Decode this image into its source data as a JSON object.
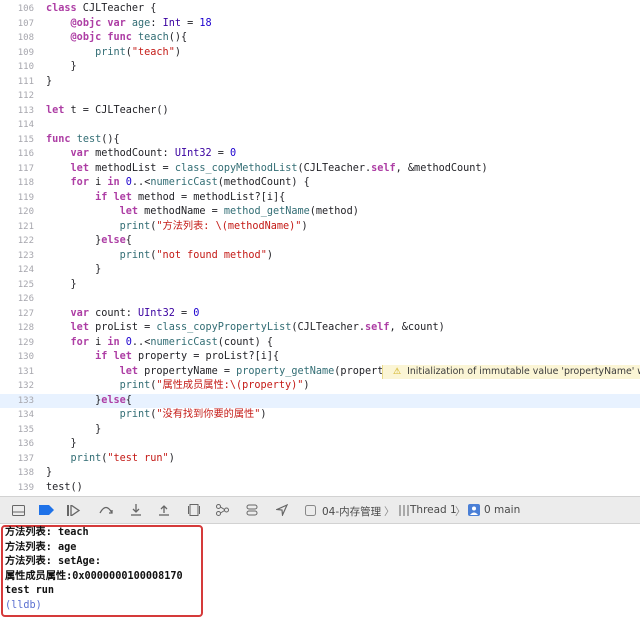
{
  "editor": {
    "current_line": "133",
    "lines": [
      {
        "n": "106",
        "html": "<span class=\"kw\">class</span> CJLTeacher {"
      },
      {
        "n": "107",
        "html": "    <span class=\"kw\">@objc</span> <span class=\"kw\">var</span> <span class=\"fn\">age</span>: <span class=\"ty\">Int</span> = <span class=\"num\">18</span>"
      },
      {
        "n": "108",
        "html": "    <span class=\"kw\">@objc</span> <span class=\"kw\">func</span> <span class=\"fn\">teach</span>(){"
      },
      {
        "n": "109",
        "html": "        <span class=\"fn\">print</span>(<span class=\"str\">\"teach\"</span>)"
      },
      {
        "n": "110",
        "html": "    }"
      },
      {
        "n": "111",
        "html": "}"
      },
      {
        "n": "112",
        "html": ""
      },
      {
        "n": "113",
        "html": "<span class=\"kw\">let</span> t = CJLTeacher()"
      },
      {
        "n": "114",
        "html": ""
      },
      {
        "n": "115",
        "html": "<span class=\"kw\">func</span> <span class=\"fn\">test</span>(){"
      },
      {
        "n": "116",
        "html": "    <span class=\"kw\">var</span> methodCount: <span class=\"ty\">UInt32</span> = <span class=\"num\">0</span>"
      },
      {
        "n": "117",
        "html": "    <span class=\"kw\">let</span> methodList = <span class=\"fn\">class_copyMethodList</span>(CJLTeacher.<span class=\"kw\">self</span>, &amp;methodCount)"
      },
      {
        "n": "118",
        "html": "    <span class=\"kw\">for</span> i <span class=\"kw\">in</span> <span class=\"num\">0</span>..&lt;<span class=\"fn\">numericCast</span>(methodCount) {"
      },
      {
        "n": "119",
        "html": "        <span class=\"kw\">if</span> <span class=\"kw\">let</span> method = methodList?[i]{"
      },
      {
        "n": "120",
        "html": "            <span class=\"kw\">let</span> methodName = <span class=\"fn\">method_getName</span>(method)"
      },
      {
        "n": "121",
        "html": "            <span class=\"fn\">print</span>(<span class=\"str\">\"方法列表: \\(methodName)\"</span>)"
      },
      {
        "n": "122",
        "html": "        }<span class=\"kw\">else</span>{"
      },
      {
        "n": "123",
        "html": "            <span class=\"fn\">print</span>(<span class=\"str\">\"not found method\"</span>)"
      },
      {
        "n": "124",
        "html": "        }"
      },
      {
        "n": "125",
        "html": "    }"
      },
      {
        "n": "126",
        "html": ""
      },
      {
        "n": "127",
        "html": "    <span class=\"kw\">var</span> count: <span class=\"ty\">UInt32</span> = <span class=\"num\">0</span>"
      },
      {
        "n": "128",
        "html": "    <span class=\"kw\">let</span> proList = <span class=\"fn\">class_copyPropertyList</span>(CJLTeacher.<span class=\"kw\">self</span>, &amp;count)"
      },
      {
        "n": "129",
        "html": "    <span class=\"kw\">for</span> i <span class=\"kw\">in</span> <span class=\"num\">0</span>..&lt;<span class=\"fn\">numericCast</span>(count) {"
      },
      {
        "n": "130",
        "html": "        <span class=\"kw\">if</span> <span class=\"kw\">let</span> property = proList?[i]{"
      },
      {
        "n": "131",
        "html": "            <span class=\"kw\">let</span> propertyName = <span class=\"fn\">property_getName</span>(property)"
      },
      {
        "n": "132",
        "html": "            <span class=\"fn\">print</span>(<span class=\"str\">\"属性成员属性:\\(property)\"</span>)"
      },
      {
        "n": "133",
        "html": "        }<span class=\"kw\">else</span>{"
      },
      {
        "n": "134",
        "html": "            <span class=\"fn\">print</span>(<span class=\"str\">\"没有找到你要的属性\"</span>)"
      },
      {
        "n": "135",
        "html": "        }"
      },
      {
        "n": "136",
        "html": "    }"
      },
      {
        "n": "137",
        "html": "    <span class=\"fn\">print</span>(<span class=\"str\">\"test run\"</span>)"
      },
      {
        "n": "138",
        "html": "}"
      },
      {
        "n": "139",
        "html": "test()"
      }
    ],
    "warning": {
      "line": "131",
      "text": "Initialization of immutable value 'propertyName' wa..."
    }
  },
  "toolbar": {
    "scheme": "04-内存管理",
    "thread": "Thread 1",
    "frame": "0 main"
  },
  "console": {
    "lines": [
      "方法列表: teach",
      "方法列表: age",
      "方法列表: setAge:",
      "属性成员属性:0x0000000100008170",
      "test run"
    ],
    "prompt": "(lldb)"
  },
  "colors": {
    "keyword": "#ad3da4",
    "string": "#c41a16",
    "highlight_box": "#d53a3a",
    "current_line": "#e8f2ff"
  }
}
